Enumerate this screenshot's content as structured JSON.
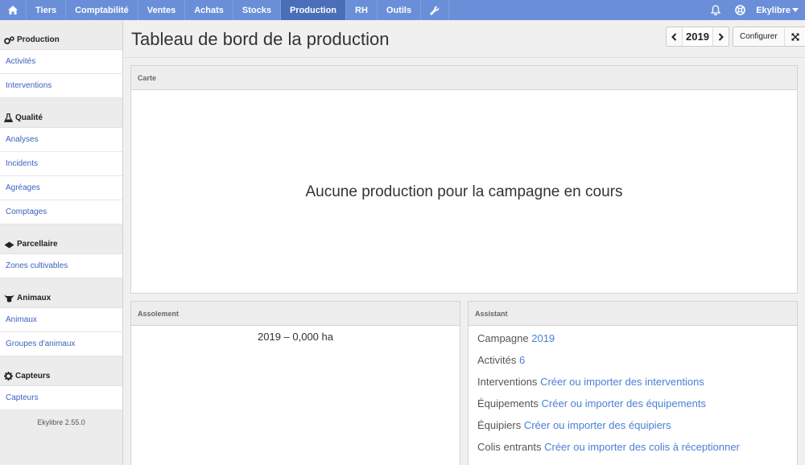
{
  "nav": {
    "items": [
      "Tiers",
      "Comptabilité",
      "Ventes",
      "Achats",
      "Stocks",
      "Production",
      "RH",
      "Outils"
    ],
    "active": "Production",
    "user": "Ekylibre"
  },
  "sidebar": {
    "groups": [
      {
        "title": "Production",
        "icon": "gears-icon",
        "items": [
          "Activités",
          "Interventions"
        ]
      },
      {
        "title": "Qualité",
        "icon": "flask-icon",
        "items": [
          "Analyses",
          "Incidents",
          "Agréages",
          "Comptages"
        ]
      },
      {
        "title": "Parcellaire",
        "icon": "land-icon",
        "items": [
          "Zones cultivables"
        ]
      },
      {
        "title": "Animaux",
        "icon": "cow-icon",
        "items": [
          "Animaux",
          "Groupes d'animaux"
        ]
      },
      {
        "title": "Capteurs",
        "icon": "gear-icon",
        "items": [
          "Capteurs"
        ]
      }
    ],
    "version": "Ekylibre 2.55.0"
  },
  "header": {
    "title": "Tableau de bord de la production",
    "year": "2019",
    "configure_label": "Configurer"
  },
  "carte": {
    "title": "Carte",
    "message": "Aucune production pour la campagne en cours"
  },
  "assolement": {
    "title": "Assolement",
    "value": "2019 – 0,000 ha"
  },
  "assistant": {
    "title": "Assistant",
    "rows": [
      {
        "label": "Campagne",
        "link": "2019"
      },
      {
        "label": "Activités",
        "link": "6"
      },
      {
        "label": "Interventions",
        "link": "Créer ou importer des interventions"
      },
      {
        "label": "Équipements",
        "link": "Créer ou importer des équipements"
      },
      {
        "label": "Équipiers",
        "link": "Créer ou importer des équipiers"
      },
      {
        "label": "Colis entrants",
        "link": "Créer ou importer des colis à réceptionner"
      }
    ]
  }
}
